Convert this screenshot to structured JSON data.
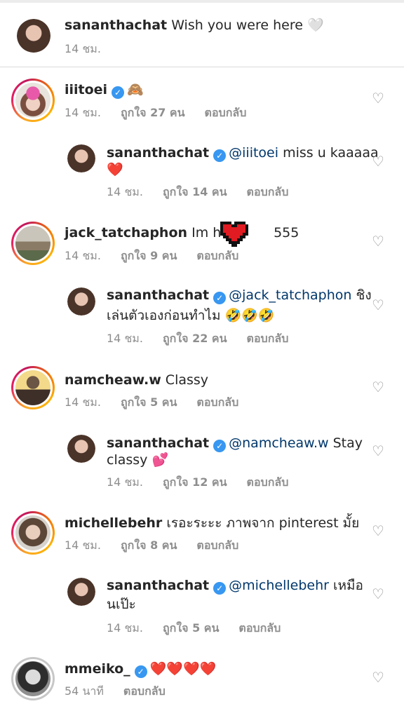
{
  "caption": {
    "username": "sananthachat",
    "text": "Wish you were here",
    "emoji": "🤍",
    "time": "14 ชม."
  },
  "comments": [
    {
      "username": "iiitoei",
      "verified": true,
      "text": "🙈",
      "time": "14 ชม.",
      "likes": "ถูกใจ 27 คน",
      "reply": "ตอบกลับ"
    },
    {
      "username": "sananthachat",
      "verified": true,
      "mention": "@iiitoei",
      "text": "miss u kaaaaa",
      "line2": "❤️",
      "time": "14 ชม.",
      "likes": "ถูกใจ 14 คน",
      "reply": "ตอบกลับ"
    },
    {
      "username": "jack_tatchaphon",
      "verified": false,
      "text": "Im here",
      "text_after": "555",
      "time": "14 ชม.",
      "likes": "ถูกใจ 9 คน",
      "reply": "ตอบกลับ"
    },
    {
      "username": "sananthachat",
      "verified": true,
      "mention": "@jack_tatchaphon",
      "text": "ชิง",
      "line2": "เล่นตัวเองก่อนทำไม 🤣🤣🤣",
      "time": "14 ชม.",
      "likes": "ถูกใจ 22 คน",
      "reply": "ตอบกลับ"
    },
    {
      "username": "namcheaw.w",
      "verified": false,
      "text": "Classy",
      "time": "14 ชม.",
      "likes": "ถูกใจ 5 คน",
      "reply": "ตอบกลับ"
    },
    {
      "username": "sananthachat",
      "verified": true,
      "mention": "@namcheaw.w",
      "text": "Stay",
      "line2": "classy 💕",
      "time": "14 ชม.",
      "likes": "ถูกใจ 12 คน",
      "reply": "ตอบกลับ"
    },
    {
      "username": "michellebehr",
      "verified": false,
      "text": "เรอะระะะ ภาพจาก pinterest มั้ย",
      "time": "14 ชม.",
      "likes": "ถูกใจ 8 คน",
      "reply": "ตอบกลับ"
    },
    {
      "username": "sananthachat",
      "verified": true,
      "mention": "@michellebehr",
      "text": "เหมือ",
      "line2": "นเป๊ะ",
      "time": "14 ชม.",
      "likes": "ถูกใจ 5 คน",
      "reply": "ตอบกลับ"
    },
    {
      "username": "mmeiko_",
      "verified": true,
      "text": "❤️❤️❤️❤️",
      "time": "54 นาที",
      "reply": "ตอบกลับ"
    }
  ],
  "icons": {
    "like": "heart-outline-icon",
    "verified": "verified-badge-icon"
  },
  "colors": {
    "verified": "#3897f0",
    "mention": "#00376b",
    "meta": "#8e8e8e",
    "heart": "#ed4956"
  }
}
